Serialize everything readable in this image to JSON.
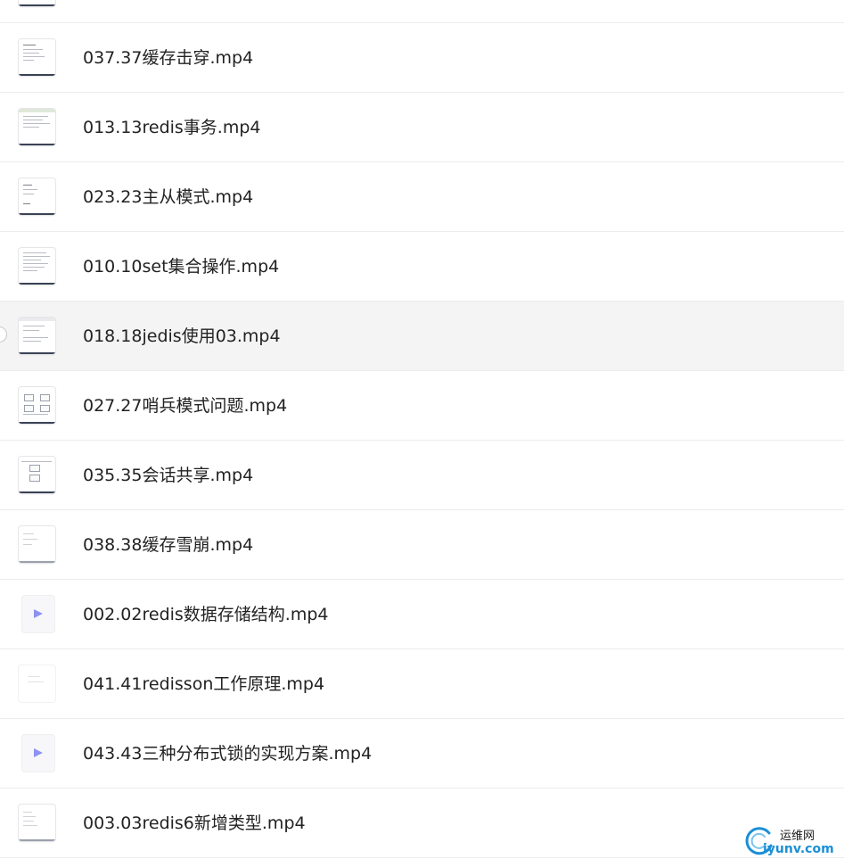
{
  "files": [
    {
      "name": "",
      "thumb": "doc",
      "partial": true
    },
    {
      "name": "037.37缓存击穿.mp4",
      "thumb": "doc"
    },
    {
      "name": "013.13redis事务.mp4",
      "thumb": "doc-green"
    },
    {
      "name": "023.23主从模式.mp4",
      "thumb": "doc"
    },
    {
      "name": "010.10set集合操作.mp4",
      "thumb": "doc"
    },
    {
      "name": "018.18jedis使用03.mp4",
      "thumb": "doc",
      "hovered": true
    },
    {
      "name": "027.27哨兵模式问题.mp4",
      "thumb": "diagram"
    },
    {
      "name": "035.35会话共享.mp4",
      "thumb": "diagram-small"
    },
    {
      "name": "038.38缓存雪崩.mp4",
      "thumb": "doc-light"
    },
    {
      "name": "002.02redis数据存储结构.mp4",
      "thumb": "video-icon"
    },
    {
      "name": "041.41redisson工作原理.mp4",
      "thumb": "doc-faint"
    },
    {
      "name": "043.43三种分布式锁的实现方案.mp4",
      "thumb": "video-icon"
    },
    {
      "name": "003.03redis6新增类型.mp4",
      "thumb": "doc-light"
    }
  ],
  "watermark": {
    "title": "运维网",
    "url": "iyunv.com",
    "color": "#1a8fd6"
  },
  "colors": {
    "row_hover": "#f4f4f4",
    "divider": "#ececec",
    "thumb_bar": "#3a4256",
    "play_icon": "#8d93f0"
  }
}
